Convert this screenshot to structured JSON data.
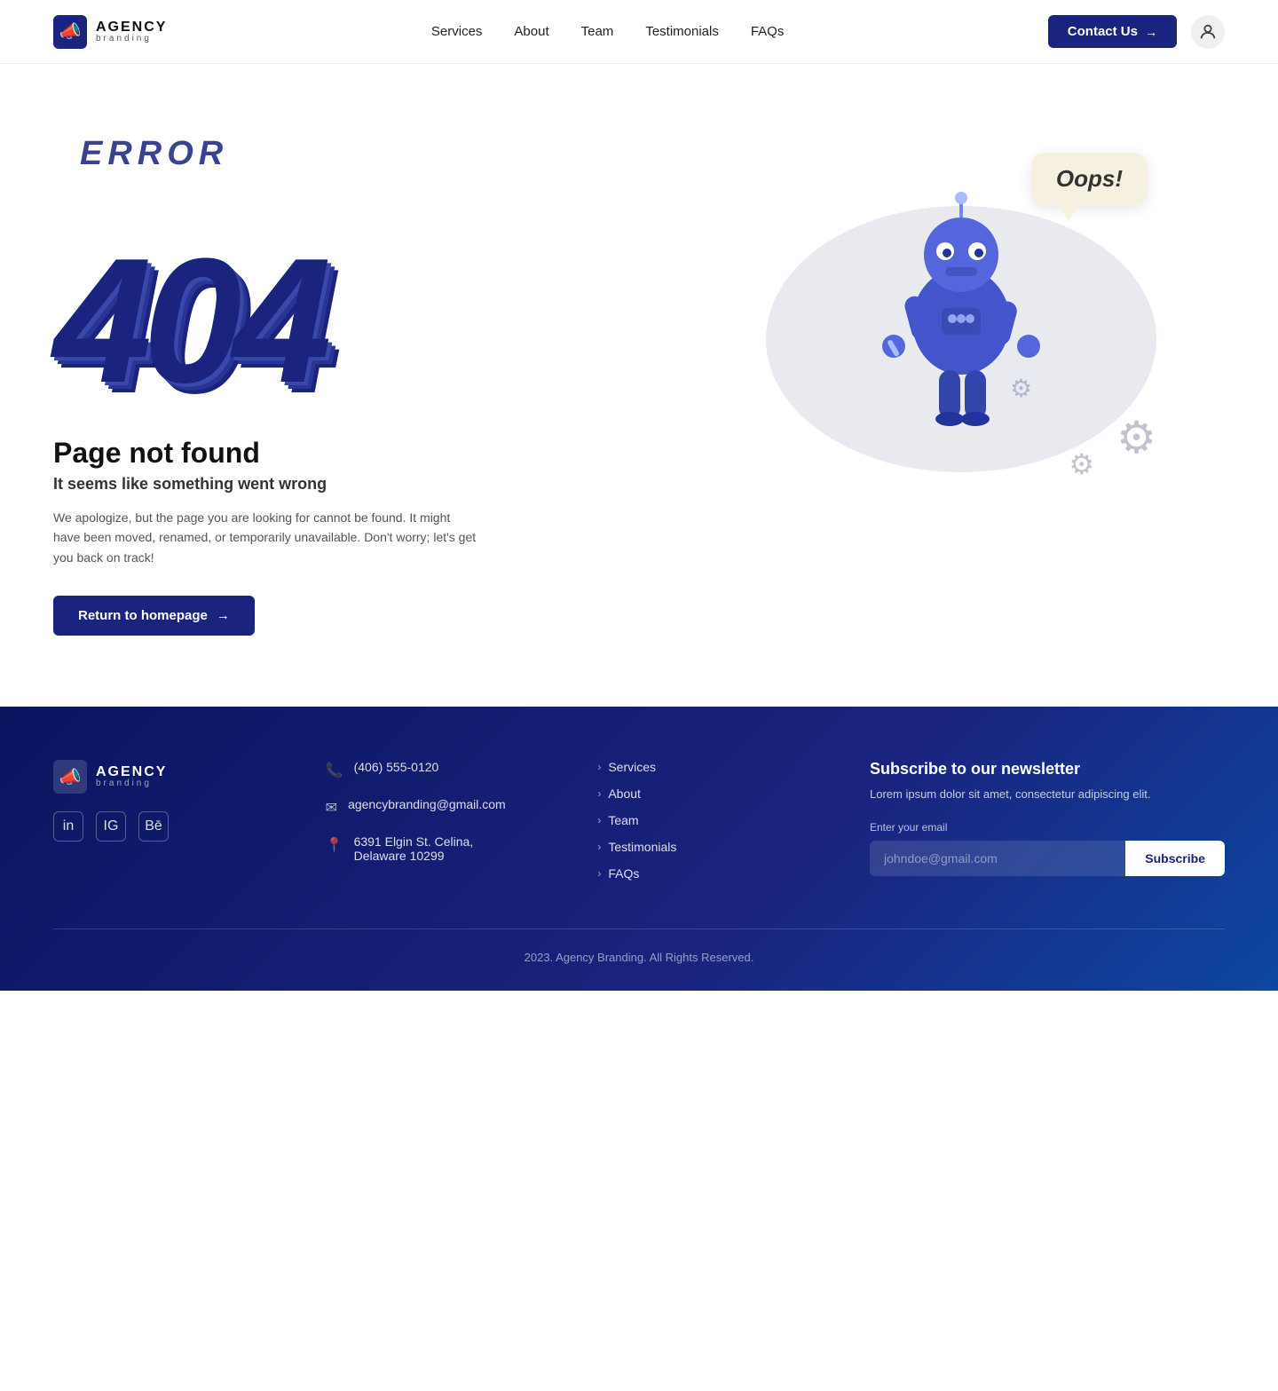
{
  "nav": {
    "logo": {
      "agency": "AGENCY",
      "branding": "branding",
      "icon": "📣"
    },
    "links": [
      {
        "label": "Services",
        "href": "#"
      },
      {
        "label": "About",
        "href": "#"
      },
      {
        "label": "Team",
        "href": "#"
      },
      {
        "label": "Testimonials",
        "href": "#"
      },
      {
        "label": "FAQs",
        "href": "#"
      }
    ],
    "contact_btn": "Contact Us",
    "contact_arrow": "→"
  },
  "error_page": {
    "error_label": "ERROR",
    "error_number": "404",
    "title": "Page not found",
    "subtitle": "It seems like something went wrong",
    "description": "We apologize, but the page you are looking for cannot be found. It might have been moved, renamed, or temporarily unavailable. Don't worry; let's get you back on track!",
    "return_btn": "Return to homepage",
    "return_arrow": "→",
    "oops": "Oops!"
  },
  "footer": {
    "logo": {
      "agency": "AGENCY",
      "branding": "branding",
      "icon": "📣"
    },
    "contact": {
      "phone": "(406) 555-0120",
      "email": "agencybranding@gmail.com",
      "address_line1": "6391 Elgin St. Celina,",
      "address_line2": "Delaware 10299"
    },
    "nav_links": [
      {
        "label": "Services"
      },
      {
        "label": "About"
      },
      {
        "label": "Team"
      },
      {
        "label": "Testimonials"
      },
      {
        "label": "FAQs"
      }
    ],
    "newsletter": {
      "title": "Subscribe to our newsletter",
      "description": "Lorem ipsum dolor sit amet, consectetur adipiscing elit.",
      "email_label": "Enter your email",
      "email_placeholder": "johndoe@gmail.com",
      "btn_label": "Subscribe"
    },
    "copyright": "2023. Agency Branding. All Rights Reserved."
  }
}
